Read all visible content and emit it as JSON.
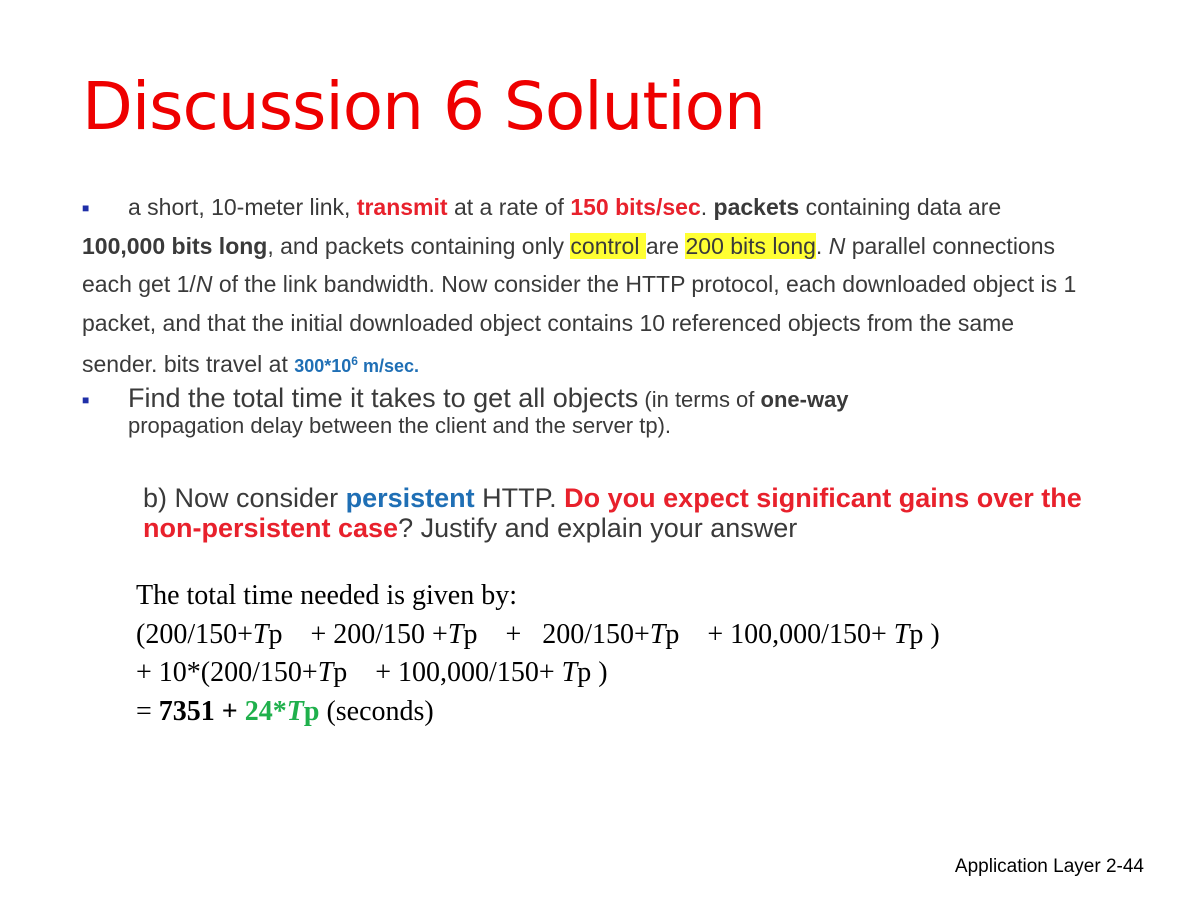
{
  "title": "Discussion 6 Solution",
  "problem": {
    "p1": "a short, 10-meter link, ",
    "transmit": "transmit",
    "p2": " at a rate of ",
    "rate": "150 bits/sec",
    "p3": ". ",
    "packets": "packets",
    "p4": " containing data are ",
    "size": "100,000 bits long",
    "p5": ", and packets containing only ",
    "control": "control ",
    "p6": "are ",
    "ctrl_size": "200 bits long",
    "p7": ". ",
    "n1": "N",
    "p8": " parallel connections each get 1/",
    "n2": "N",
    "p9": " of the link bandwidth. Now consider the HTTP protocol, each downloaded object is 1 packet, and that the initial downloaded object contains 10 referenced objects from the same sender. bits travel at ",
    "speed": "300*10",
    "speed_exp": "6",
    "speed_unit": " m/sec."
  },
  "find": {
    "main": "Find the total time it takes to get all objects",
    "paren": " (in terms of ",
    "oneway": "one-way",
    "line2": "propagation delay between the client and the server tp)."
  },
  "question_b": {
    "p1": "b) Now consider ",
    "persistent": "persistent",
    "p2": " HTTP. ",
    "gain": "Do you expect significant gains over the non-persistent case",
    "p3": "? Justify and explain your answer"
  },
  "solution": {
    "line1": "The total time needed is given by:",
    "line2_a": "(200/150+",
    "line2_b": "p    + 200/150 +",
    "line2_c": "p    +   200/150+",
    "line2_d": "p    + 100,000/150+ ",
    "line2_e": "p )",
    "line3_a": "+ 10*(200/150+",
    "line3_b": "p    + 100,000/150+ ",
    "line3_c": "p )",
    "line4_a": "= ",
    "result_a": "7351 + ",
    "result_b": "24*",
    "result_c": "T",
    "result_d": "p",
    "line4_b": " (seconds)",
    "t": "T"
  },
  "footer": "Application Layer 2-44"
}
